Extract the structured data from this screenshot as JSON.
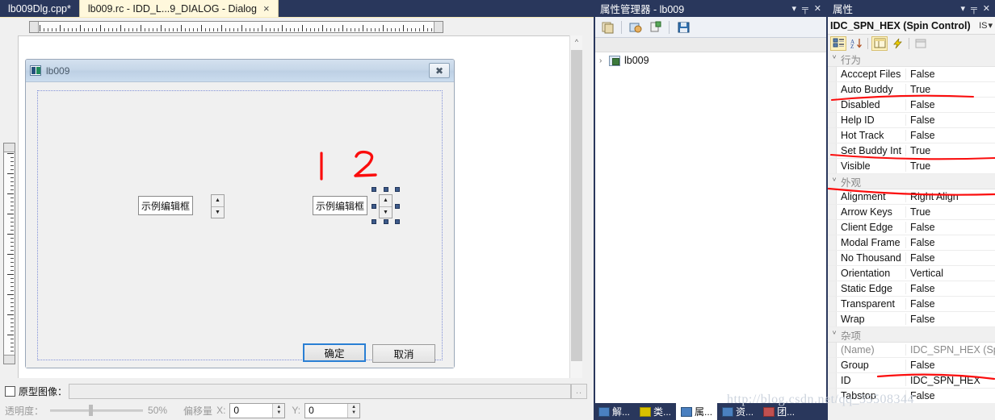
{
  "tabs": [
    {
      "label": "lb009Dlg.cpp*",
      "active": false,
      "close": ""
    },
    {
      "label": "lb009.rc - IDD_L...9_DIALOG - Dialog",
      "active": true,
      "close": "×"
    }
  ],
  "dialog_preview": {
    "title": "lb009",
    "close_glyph": "✖",
    "edit_left_text": "示例编辑框",
    "edit_right_text": "示例编辑框",
    "spin_up": "▲",
    "spin_down": "▼",
    "ok_button": "确定",
    "cancel_button": "取消"
  },
  "annotations": {
    "mark_one": "1",
    "mark_two": "2"
  },
  "prototype_bar": {
    "checkbox_label": "原型图像：",
    "path_value": "",
    "browse_label": "..",
    "transparency_label": "透明度：",
    "transparency_value": "50%",
    "offset_label": "偏移量",
    "offset_x_label": "X:",
    "offset_x_value": "0",
    "offset_y_label": "Y:",
    "offset_y_value": "0",
    "spin_up": "▲",
    "spin_down": "▼"
  },
  "property_manager": {
    "caption": "属性管理器 - lb009",
    "caption_actions": {
      "dropdown": "▾",
      "pin": "╤",
      "close": "✕"
    },
    "toolbar_icons": [
      "add-property-sheet-icon",
      "add-new-project-property-sheet-icon",
      "add-existing-property-sheet-icon",
      "save-icon"
    ],
    "tree": [
      {
        "expander": "›",
        "label": "lb009"
      }
    ]
  },
  "properties_panel": {
    "caption": "属性",
    "caption_actions": {
      "dropdown": "▾",
      "pin": "╤",
      "close": "✕"
    },
    "object_name": "IDC_SPN_HEX (Spin Control)",
    "object_combo_suffix": "IS",
    "object_combo_arrow": "▾",
    "toolbar_icons": [
      "categorized-view-icon",
      "alphabetical-view-icon",
      "properties-view-icon",
      "events-view-icon",
      "property-pages-icon"
    ],
    "groups": [
      {
        "name": "行为",
        "chevron": "ⱽ",
        "rows": [
          {
            "name": "Acccept Files",
            "value": "False"
          },
          {
            "name": "Auto Buddy",
            "value": "True"
          },
          {
            "name": "Disabled",
            "value": "False"
          },
          {
            "name": "Help ID",
            "value": "False"
          },
          {
            "name": "Hot Track",
            "value": "False"
          },
          {
            "name": "Set Buddy Int",
            "value": "True"
          },
          {
            "name": "Visible",
            "value": "True"
          }
        ]
      },
      {
        "name": "外观",
        "chevron": "ⱽ",
        "rows": [
          {
            "name": "Alignment",
            "value": "Right Align"
          },
          {
            "name": "Arrow Keys",
            "value": "True"
          },
          {
            "name": "Client Edge",
            "value": "False"
          },
          {
            "name": "Modal Frame",
            "value": "False"
          },
          {
            "name": "No Thousand",
            "value": "False"
          },
          {
            "name": "Orientation",
            "value": "Vertical"
          },
          {
            "name": "Static Edge",
            "value": "False"
          },
          {
            "name": "Transparent",
            "value": "False"
          },
          {
            "name": "Wrap",
            "value": "False"
          }
        ]
      },
      {
        "name": "杂项",
        "chevron": "ⱽ",
        "rows": [
          {
            "name": "(Name)",
            "value": "IDC_SPN_HEX (Sp",
            "grey": true
          },
          {
            "name": "Group",
            "value": "False"
          },
          {
            "name": "ID",
            "value": "IDC_SPN_HEX"
          },
          {
            "name": "Tabstop",
            "value": "False"
          }
        ]
      }
    ]
  },
  "bottom_tabs": [
    {
      "label": "解...",
      "icon": "solution-explorer-icon",
      "selected": false
    },
    {
      "label": "类...",
      "icon": "class-view-icon",
      "selected": false
    },
    {
      "label": "属...",
      "icon": "property-manager-icon",
      "selected": true
    },
    {
      "label": "资...",
      "icon": "resource-view-icon",
      "selected": false
    },
    {
      "label": "团...",
      "icon": "team-explorer-icon",
      "selected": false
    }
  ],
  "watermark": "http://blog.csdn.net/qq_35508344",
  "colors": {
    "chrome": "#29375c",
    "active_tab": "#fff8dc",
    "ink_red": "#fb0d0d",
    "selection_handle": "#3d5a8a"
  }
}
